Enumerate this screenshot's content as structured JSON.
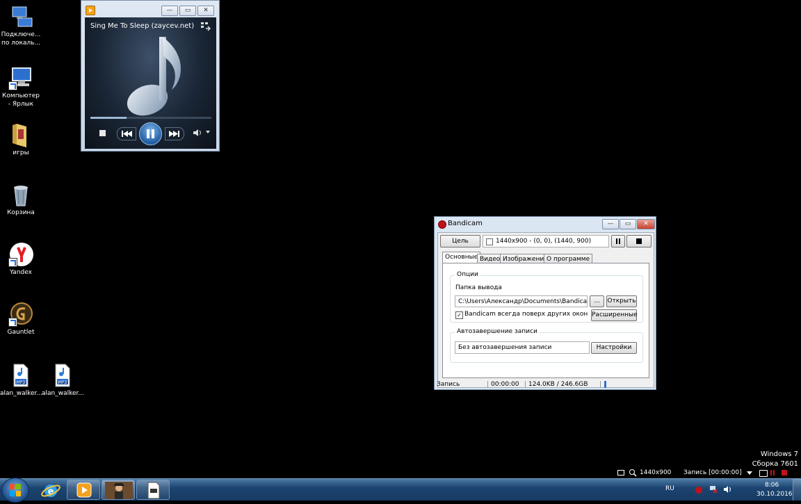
{
  "desktop": {
    "icons": [
      {
        "label": "Подключе...\nпо локаль...",
        "name": "network-connection"
      },
      {
        "label": "Компьютер - Ярлык",
        "name": "computer-shortcut"
      },
      {
        "label": "игры",
        "name": "games-folder"
      },
      {
        "label": "Корзина",
        "name": "recycle-bin"
      },
      {
        "label": "Yandex",
        "name": "yandex"
      },
      {
        "label": "Gauntlet",
        "name": "gauntlet"
      },
      {
        "label": "alan_walker...",
        "name": "mp3-file-1"
      },
      {
        "label": "alan_walker...",
        "name": "mp3-file-2"
      }
    ],
    "mp3_badge": "MP3",
    "watermark_line1": "Windows 7",
    "watermark_line2": "Сборка 7601"
  },
  "wmp": {
    "title": "Sing Me To Sleep (zaycev.net)",
    "progress": 0.3,
    "minimize": "—",
    "restore": "▭",
    "close": "✕"
  },
  "bandicam": {
    "title": "Bandicam",
    "target_button": "Цель",
    "area_text": "1440x900 - (0, 0), (1440, 900)",
    "tabs": [
      "Основные",
      "Видео",
      "Изображение",
      "О программе"
    ],
    "options_group": "Опции",
    "output_folder_label": "Папка вывода",
    "output_folder_value": "C:\\Users\\Александр\\Documents\\Bandicam\\",
    "browse_button": "...",
    "open_button": "Открыть",
    "always_on_top_label": "Bandicam всегда поверх других окон",
    "always_on_top_checked": true,
    "advanced_button": "Расширенные",
    "autocomplete_group": "Автозавершение записи",
    "autocomplete_value": "Без автозавершения записи",
    "settings_button": "Настройки",
    "status_label": "Запись",
    "status_time": "00:00:00",
    "status_size": "124.0KB / 246.6GB"
  },
  "rec_bar": {
    "resolution": "1440x900",
    "recording": "Запись [00:00:00]"
  },
  "taskbar": {
    "language": "RU",
    "time": "8:06",
    "date": "30.10.2016"
  },
  "colors": {
    "accent": "#2a6fd6",
    "record_red": "#c0121b"
  }
}
